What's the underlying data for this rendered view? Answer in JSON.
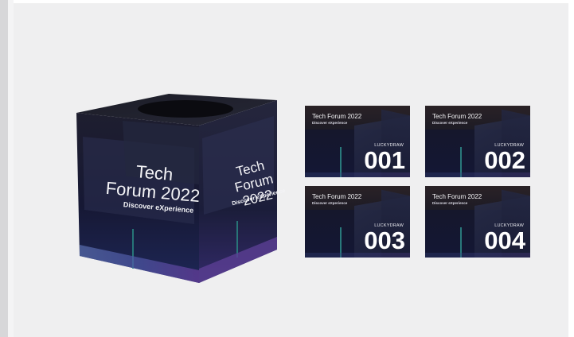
{
  "box": {
    "front_title": "Tech\nForum 2022",
    "front_subtitle": "Discover eXperience",
    "side_title": "Tech\nForum 2022",
    "side_subtitle": "Discover eXperience"
  },
  "cards": [
    {
      "title": "Tech Forum 2022",
      "subtitle": "Discover eXperience",
      "label": "LUCKYDRAW",
      "number": "001"
    },
    {
      "title": "Tech Forum 2022",
      "subtitle": "Discover eXperience",
      "label": "LUCKYDRAW",
      "number": "002"
    },
    {
      "title": "Tech Forum 2022",
      "subtitle": "Discover eXperience",
      "label": "LUCKYDRAW",
      "number": "003"
    },
    {
      "title": "Tech Forum 2022",
      "subtitle": "Discover eXperience",
      "label": "LUCKYDRAW",
      "number": "004"
    }
  ],
  "colors": {
    "canvas": "#efeff0",
    "box_dark": "#171728",
    "box_side": "#24253b",
    "accent_purple": "#5b3f93"
  }
}
